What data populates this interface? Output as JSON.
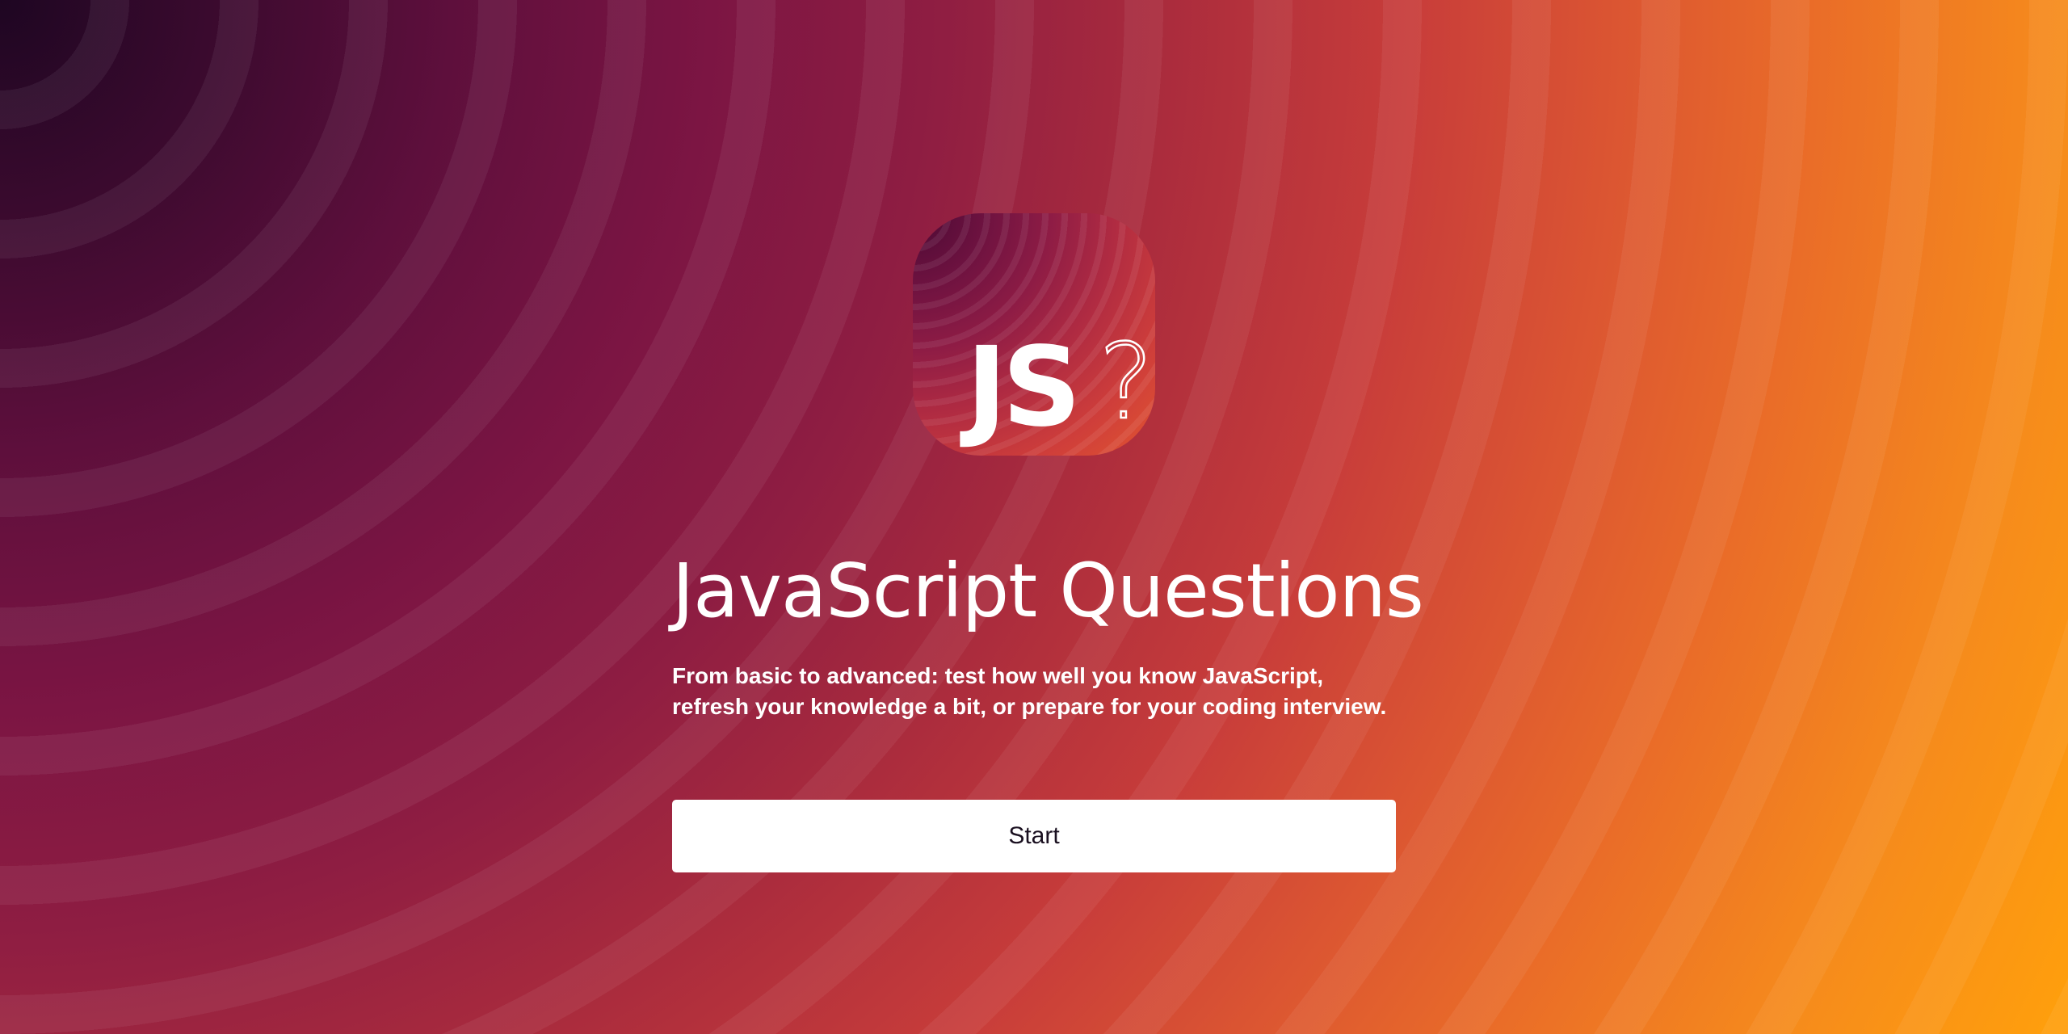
{
  "logo": {
    "text": "JS",
    "symbol": "?"
  },
  "hero": {
    "title": "JavaScript Questions",
    "subtitle": "From basic to advanced: test how well you know JavaScript, refresh your knowledge a bit, or prepare for your coding interview."
  },
  "actions": {
    "start_label": "Start"
  },
  "colors": {
    "button_background": "#ffffff",
    "button_text": "#1a1020",
    "text": "#ffffff",
    "gradient_dark": "#1e0622",
    "gradient_mid": "#8e1d42",
    "gradient_light": "#ff9f0c"
  }
}
